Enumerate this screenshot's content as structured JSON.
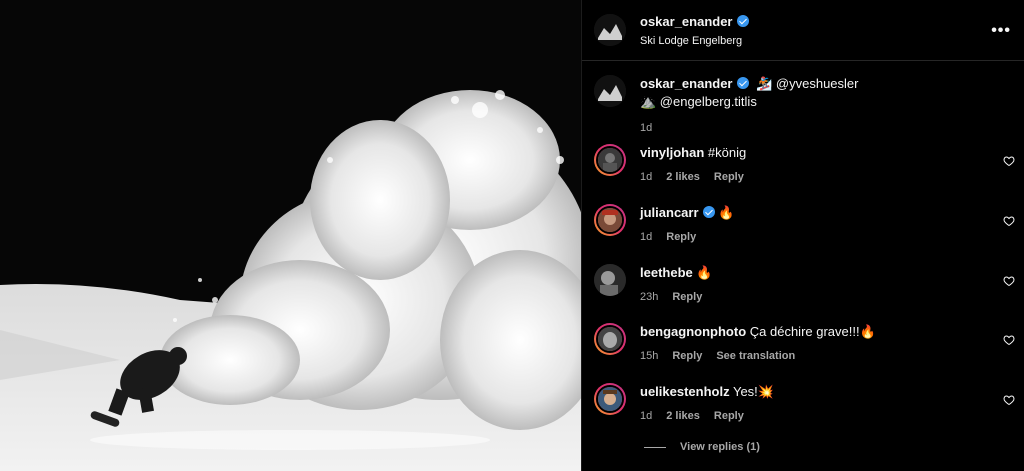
{
  "post": {
    "author": "oskar_enander",
    "location": "Ski Lodge Engelberg",
    "more_icon": "more-horizontal-icon"
  },
  "caption": {
    "author": "oskar_enander",
    "line1": "🏂 @yveshuesler",
    "line2": "⛰️ @engelberg.titlis",
    "time": "1d"
  },
  "comments": [
    {
      "user": "vinyljohan",
      "text": "#könig",
      "time": "1d",
      "likes": "2 likes",
      "reply": "Reply",
      "extra": ""
    },
    {
      "user": "juliancarr",
      "text": "🔥",
      "time": "1d",
      "likes": "",
      "reply": "Reply",
      "extra": "",
      "verified": true
    },
    {
      "user": "leethebe",
      "text": "🔥",
      "time": "23h",
      "likes": "",
      "reply": "Reply",
      "extra": ""
    },
    {
      "user": "bengagnonphoto",
      "text": "Ça déchire grave!!!🔥",
      "time": "15h",
      "likes": "",
      "reply": "Reply",
      "extra": "See translation"
    },
    {
      "user": "uelikestenholz",
      "text": "Yes!💥",
      "time": "1d",
      "likes": "2 likes",
      "reply": "Reply",
      "extra": ""
    }
  ],
  "view_replies": "View replies (1)",
  "colors": {
    "bg": "#000000",
    "text": "#f5f5f5",
    "muted": "#a8a8a8",
    "verified": "#3897f0"
  }
}
